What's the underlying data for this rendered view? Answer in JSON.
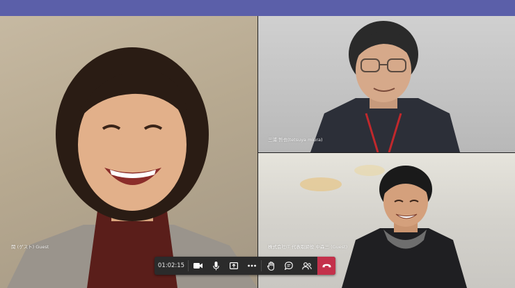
{
  "app": {
    "brand_color": "#5b5fa9",
    "hangup_color": "#c4314b"
  },
  "participants": [
    {
      "name": "関 (ゲスト) Guest",
      "tile": "main-left"
    },
    {
      "name": "三浦 哲也(tetsuya miura)",
      "tile": "top-right"
    },
    {
      "name": "株式会社IT 代表取締役 中森三 (Guest)",
      "tile": "bottom-right"
    }
  ],
  "toolbar": {
    "timer": "01:02:15",
    "buttons": [
      {
        "icon": "camera-icon"
      },
      {
        "icon": "microphone-icon"
      },
      {
        "icon": "share-screen-icon"
      },
      {
        "icon": "more-options-icon"
      },
      {
        "icon": "raise-hand-icon"
      },
      {
        "icon": "chat-icon"
      },
      {
        "icon": "participants-icon"
      },
      {
        "icon": "hang-up-icon"
      }
    ]
  }
}
